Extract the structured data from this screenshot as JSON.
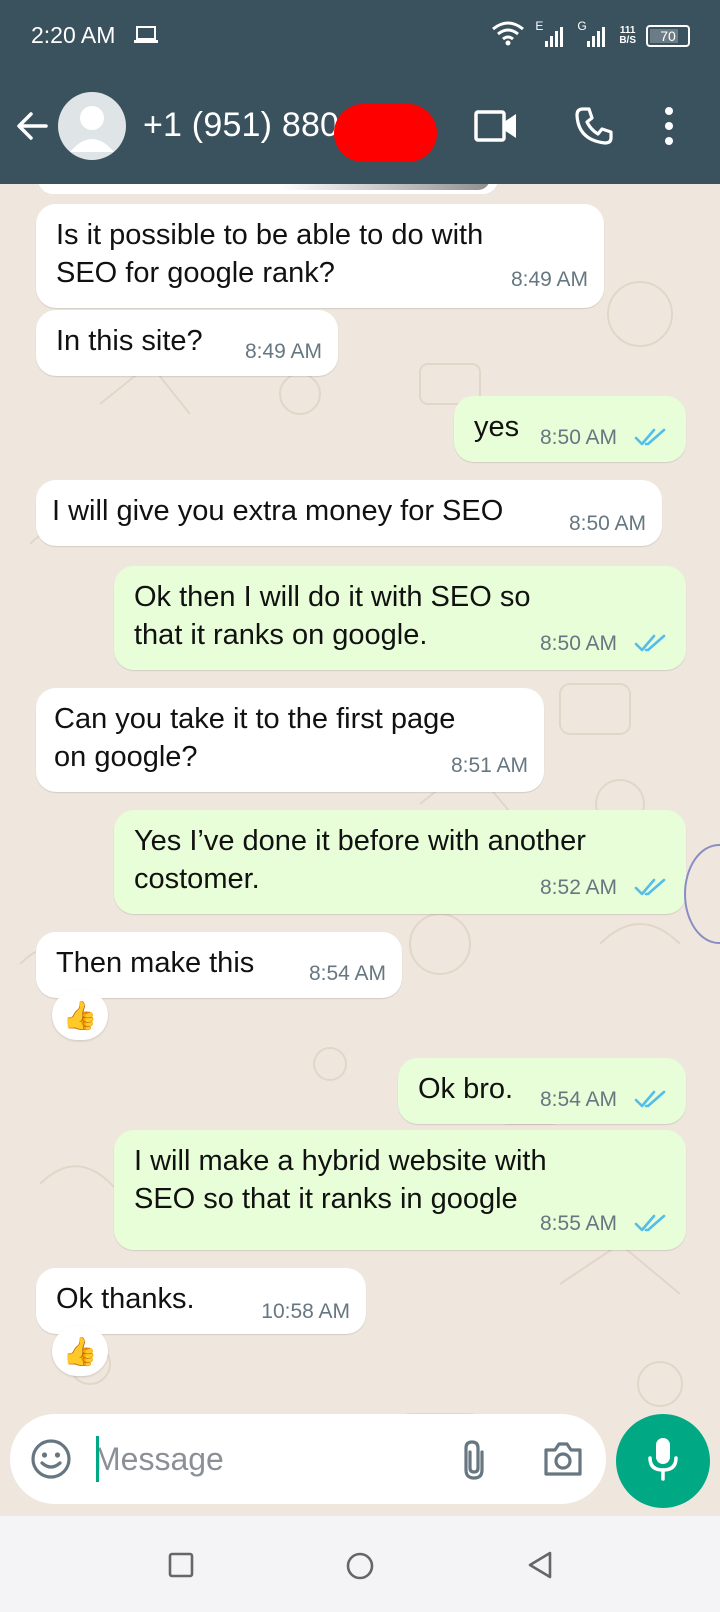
{
  "status_bar": {
    "time": "2:20 AM",
    "signal1_label": "E",
    "signal2_label": "G",
    "speed_value": "111",
    "speed_unit": "B/S",
    "battery": "70"
  },
  "header": {
    "contact_name": "+1 (951) 880"
  },
  "messages": [
    {
      "dir": "in",
      "text": "Is it possible to be able to do with\nSEO for google rank?",
      "time": "8:49 AM"
    },
    {
      "dir": "in",
      "text": "In this site?",
      "time": "8:49 AM"
    },
    {
      "dir": "out",
      "text": "yes",
      "time": "8:50 AM"
    },
    {
      "dir": "in",
      "text": "I will give you extra money for SEO",
      "time": "8:50 AM"
    },
    {
      "dir": "out",
      "text": "Ok then I will do it with SEO so\nthat it ranks on google.",
      "time": "8:50 AM"
    },
    {
      "dir": "in",
      "text": "Can you take it to the first page\non google?",
      "time": "8:51 AM"
    },
    {
      "dir": "out",
      "text": "Yes I’ve done it before with another\ncostomer.",
      "time": "8:52 AM"
    },
    {
      "dir": "in",
      "text": "Then make this",
      "time": "8:54 AM",
      "reaction": "👍"
    },
    {
      "dir": "out",
      "text": "Ok bro.",
      "time": "8:54 AM"
    },
    {
      "dir": "out",
      "text": "I will make a hybrid website with\nSEO so that it ranks in google",
      "time": "8:55 AM"
    },
    {
      "dir": "in",
      "text": "Ok thanks.",
      "time": "10:58 AM",
      "reaction": "👍"
    }
  ],
  "input": {
    "placeholder": "Message"
  },
  "colors": {
    "header_bg": "#3a515e",
    "chat_bg": "#efe7de",
    "incoming_bubble": "#ffffff",
    "outgoing_bubble": "#e7fed8",
    "read_ticks": "#53bdeb",
    "accent": "#00a884"
  },
  "icons": {
    "back": "arrow-left-icon",
    "video": "video-camera-icon",
    "call": "phone-icon",
    "menu": "more-vertical-icon",
    "emoji": "emoji-icon",
    "attach": "paperclip-icon",
    "camera": "camera-icon",
    "mic": "microphone-icon"
  }
}
